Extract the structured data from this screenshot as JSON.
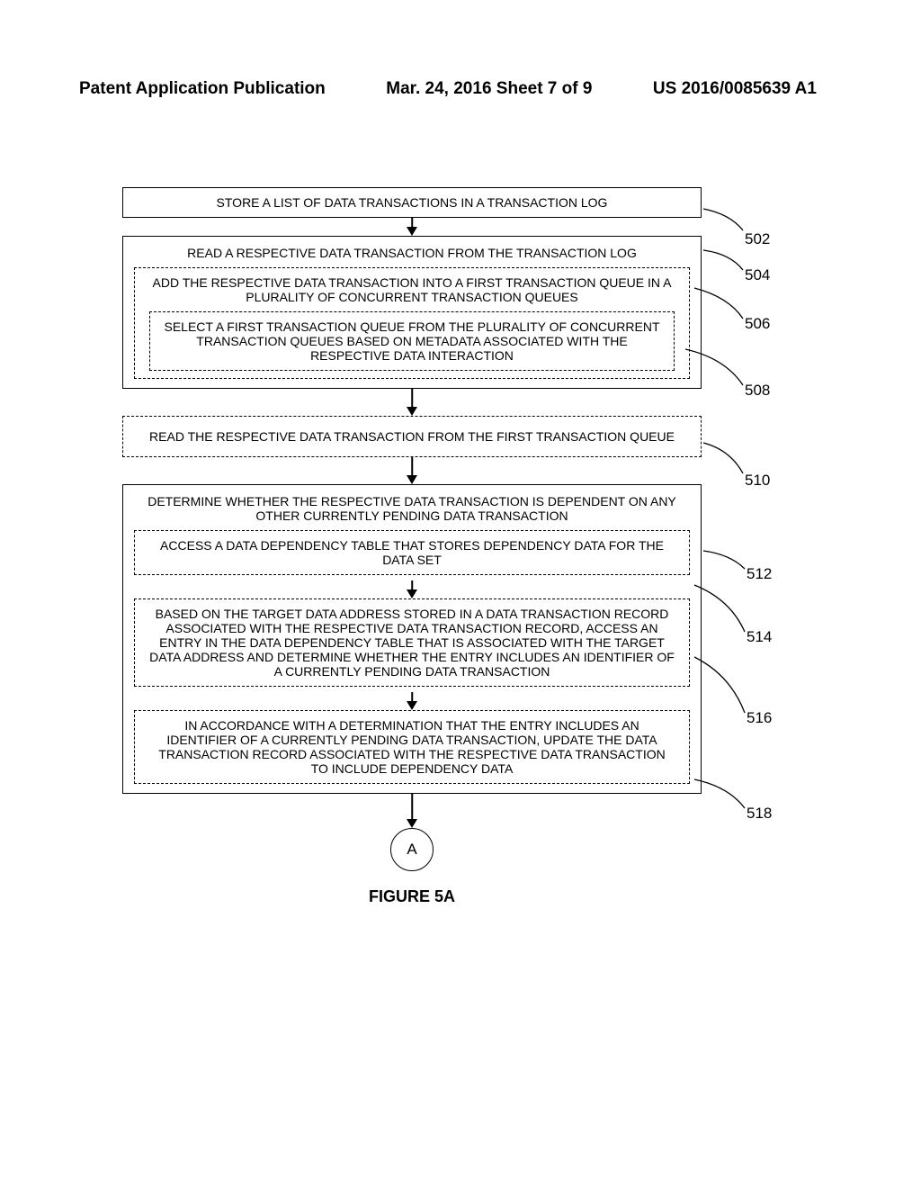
{
  "header": {
    "left": "Patent Application Publication",
    "center": "Mar. 24, 2016  Sheet 7 of 9",
    "right": "US 2016/0085639 A1"
  },
  "blocks": {
    "b502": "STORE A LIST OF DATA TRANSACTIONS IN A TRANSACTION LOG",
    "b504_outer_title": "READ A RESPECTIVE DATA TRANSACTION FROM THE TRANSACTION LOG",
    "b506": "ADD THE RESPECTIVE DATA TRANSACTION INTO A FIRST TRANSACTION QUEUE IN A PLURALITY OF CONCURRENT TRANSACTION QUEUES",
    "b508": "SELECT A FIRST TRANSACTION QUEUE FROM THE PLURALITY OF CONCURRENT TRANSACTION QUEUES BASED ON METADATA ASSOCIATED WITH THE RESPECTIVE DATA INTERACTION",
    "b510": "READ THE RESPECTIVE DATA TRANSACTION FROM THE FIRST TRANSACTION QUEUE",
    "b512_outer_title": "DETERMINE WHETHER THE RESPECTIVE DATA TRANSACTION IS DEPENDENT ON ANY OTHER CURRENTLY PENDING DATA TRANSACTION",
    "b514": "ACCESS A DATA DEPENDENCY TABLE THAT STORES DEPENDENCY DATA FOR THE DATA SET",
    "b516": "BASED ON THE TARGET DATA ADDRESS STORED IN A DATA TRANSACTION RECORD ASSOCIATED WITH THE RESPECTIVE DATA TRANSACTION RECORD, ACCESS AN ENTRY IN THE DATA DEPENDENCY TABLE THAT IS ASSOCIATED WITH THE TARGET DATA ADDRESS AND DETERMINE WHETHER THE ENTRY INCLUDES AN IDENTIFIER OF A CURRENTLY PENDING DATA TRANSACTION",
    "b518": "IN ACCORDANCE WITH A DETERMINATION THAT THE ENTRY INCLUDES AN IDENTIFIER OF A CURRENTLY PENDING DATA TRANSACTION, UPDATE THE DATA TRANSACTION RECORD ASSOCIATED WITH THE RESPECTIVE DATA TRANSACTION TO INCLUDE DEPENDENCY DATA"
  },
  "refs": {
    "r502": "502",
    "r504": "504",
    "r506": "506",
    "r508": "508",
    "r510": "510",
    "r512": "512",
    "r514": "514",
    "r516": "516",
    "r518": "518"
  },
  "connector": "A",
  "figure": "FIGURE 5A"
}
